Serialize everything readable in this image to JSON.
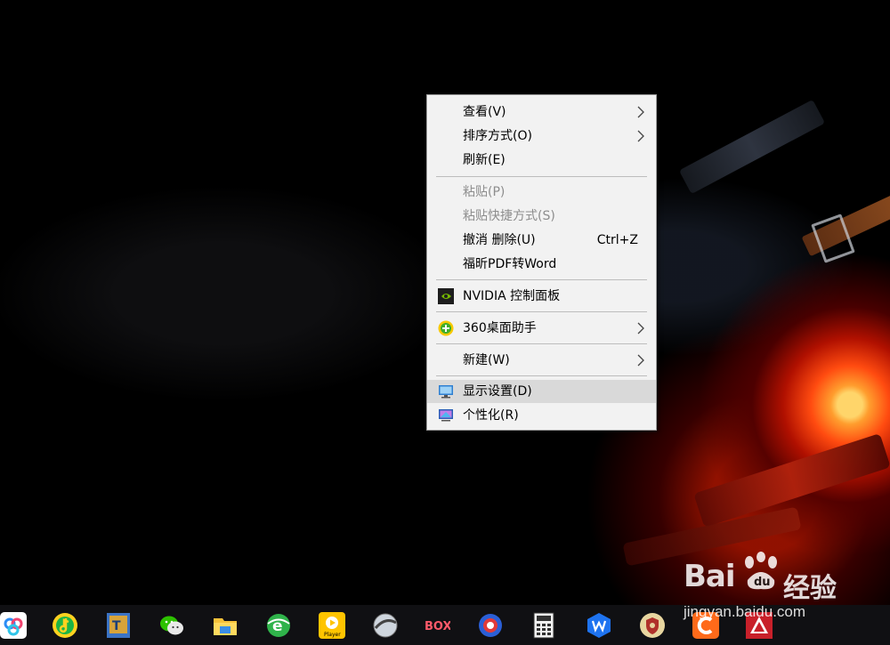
{
  "context_menu": {
    "view": "查看(V)",
    "sort_by": "排序方式(O)",
    "refresh": "刷新(E)",
    "paste": "粘贴(P)",
    "paste_shortcut": "粘贴快捷方式(S)",
    "undo_delete": "撤消 删除(U)",
    "undo_shortcut": "Ctrl+Z",
    "foxit_pdf_to_word": "福昕PDF转Word",
    "nvidia_control_panel": "NVIDIA 控制面板",
    "desktop_assistant_360": "360桌面助手",
    "new": "新建(W)",
    "display_settings": "显示设置(D)",
    "personalize": "个性化(R)"
  },
  "icons": {
    "submenu_arrow": "chevron-right-icon",
    "nvidia": "nvidia-icon",
    "assistant_360": "360-assistant-icon",
    "display": "display-settings-icon",
    "personalize": "personalize-icon"
  },
  "taskbar": {
    "apps": [
      "baidu-netdisk-icon",
      "qq-music-icon",
      "app-icon",
      "wechat-icon",
      "file-explorer-icon",
      "browser-icon",
      "player-icon",
      "tyo-icon",
      "box-icon",
      "orb-icon",
      "calculator-icon",
      "wps-icon",
      "shield-icon",
      "c-app-icon",
      "red-app-icon"
    ],
    "player_text": "Player",
    "box_text": "BOX"
  },
  "watermark": {
    "brand": "Bai",
    "brand_cn": "经验",
    "url": "jingyan.baidu.com"
  },
  "colors": {
    "menu_bg": "#f2f2f2",
    "menu_highlight": "#d9d9d9",
    "disabled_text": "#8d8d8d",
    "taskbar_bg": "#101013"
  }
}
